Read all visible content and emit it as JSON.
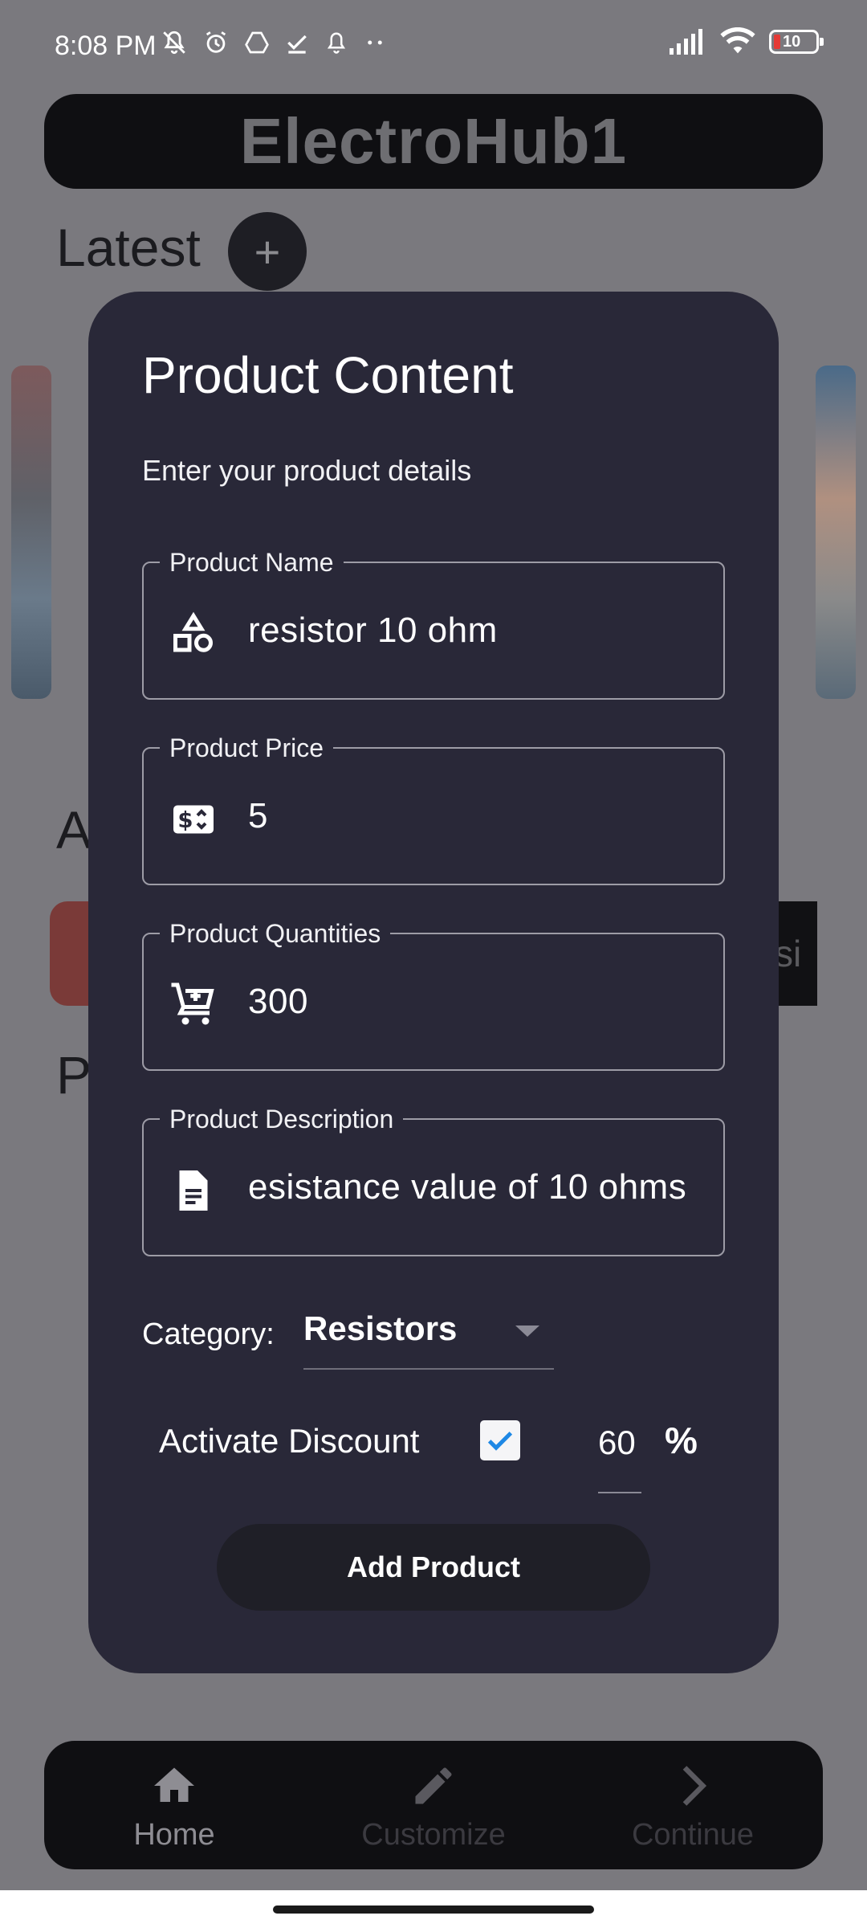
{
  "status_bar": {
    "time": "8:08 PM",
    "battery": "10"
  },
  "app": {
    "title": "ElectroHub1"
  },
  "background": {
    "latest_label": "Latest",
    "latest_add_symbol": "+",
    "section_a_partial": "A",
    "section_p_partial": "P",
    "card_partial_text": "si"
  },
  "modal": {
    "title": "Product Content",
    "subtitle": "Enter your product details",
    "fields": [
      {
        "label": "Product Name",
        "value": "resistor 10 ohm",
        "icon": "shapes-icon"
      },
      {
        "label": "Product Price",
        "value": "5",
        "icon": "price-tag-icon"
      },
      {
        "label": "Product Quantities",
        "value": "300",
        "icon": "add-shopping-cart-icon"
      },
      {
        "label": "Product Description",
        "value": "esistance value of 10 ohms",
        "icon": "description-icon"
      }
    ],
    "category": {
      "label": "Category:",
      "selected": "Resistors"
    },
    "discount": {
      "label": "Activate Discount",
      "checked": true,
      "value": "60",
      "unit": "%"
    },
    "submit_label": "Add Product"
  },
  "bottom_nav": {
    "items": [
      {
        "label": "Home",
        "icon": "home-icon",
        "active": true
      },
      {
        "label": "Customize",
        "icon": "pencil-icon",
        "active": false
      },
      {
        "label": "Continue",
        "icon": "chevron-right-icon",
        "active": false
      }
    ]
  },
  "colors": {
    "scrim": "#7a797e",
    "modal_bg": "#292838",
    "nav_bg": "#0f0f12",
    "checkbox_accent": "#1e88e5"
  }
}
